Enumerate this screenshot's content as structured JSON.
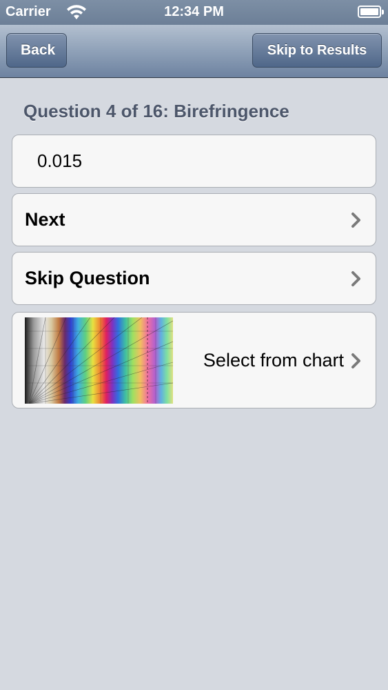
{
  "status_bar": {
    "carrier": "Carrier",
    "time": "12:34 PM"
  },
  "nav": {
    "back_label": "Back",
    "skip_results_label": "Skip to Results"
  },
  "question": {
    "title": "Question 4 of 16: Birefringence",
    "answer_value": "0.015"
  },
  "rows": {
    "next_label": "Next",
    "skip_question_label": "Skip Question",
    "chart_label": "Select from chart"
  },
  "icons": {
    "chevron": "chevron-right-icon",
    "wifi": "wifi-icon",
    "battery": "battery-icon"
  },
  "colors": {
    "nav_tint": "#6d82a0",
    "title_color": "#4c566a",
    "chevron_color": "#7a7a7a"
  }
}
